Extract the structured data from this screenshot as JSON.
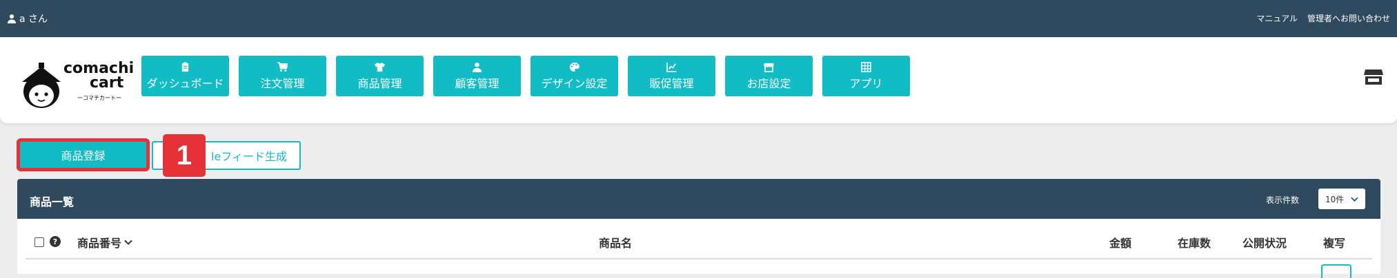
{
  "topbar": {
    "user_icon": "user-icon",
    "user_label": "a さん",
    "manual_link": "マニュアル",
    "contact_link": "管理者へお問い合わせ"
  },
  "logo": {
    "brand_line1": "comachi",
    "brand_line2": "cart",
    "brand_sub": "ーコマチカートー"
  },
  "nav": {
    "items": [
      {
        "label": "ダッシュボード",
        "icon": "clipboard-icon"
      },
      {
        "label": "注文管理",
        "icon": "cart-icon"
      },
      {
        "label": "商品管理",
        "icon": "shirt-icon"
      },
      {
        "label": "顧客管理",
        "icon": "user-icon"
      },
      {
        "label": "デザイン設定",
        "icon": "palette-icon"
      },
      {
        "label": "販促管理",
        "icon": "chart-line-icon"
      },
      {
        "label": "お店設定",
        "icon": "store-icon"
      },
      {
        "label": "アプリ",
        "icon": "grid-icon"
      }
    ],
    "store_icon": "store-icon"
  },
  "actions": {
    "register_label": "商品登録",
    "feed_label": "leフィード生成",
    "step_badge": "1"
  },
  "panel": {
    "title": "商品一覧",
    "count_label": "表示件数",
    "count_value": "10件"
  },
  "table": {
    "help_glyph": "?",
    "columns": {
      "number": "商品番号",
      "name": "商品名",
      "price": "金額",
      "stock": "在庫数",
      "status": "公開状況",
      "copy": "複写"
    }
  },
  "colors": {
    "accent": "#12bcc4",
    "header": "#2f4a5e",
    "highlight": "#e53238"
  }
}
